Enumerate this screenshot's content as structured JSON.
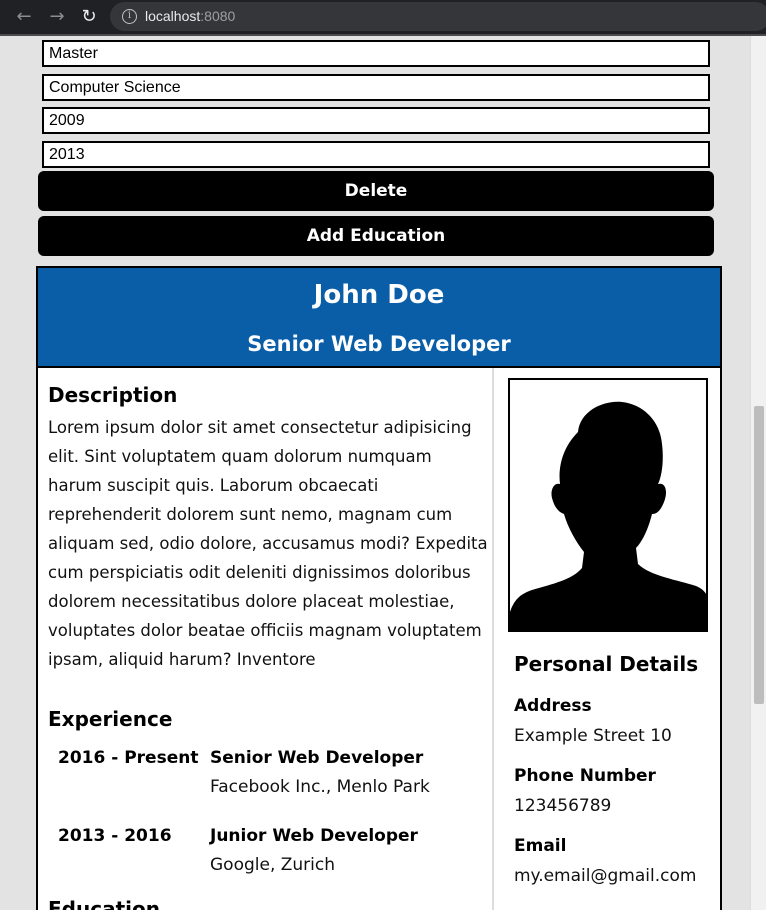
{
  "browser": {
    "url_host": "localhost",
    "url_port": ":8080",
    "back_icon": "arrow-left-icon",
    "forward_icon": "arrow-right-icon",
    "reload_icon": "reload-icon"
  },
  "form": {
    "degree": "Master",
    "field": "Computer Science",
    "start_year": "2009",
    "end_year": "2013",
    "delete_label": "Delete",
    "add_education_label": "Add Education"
  },
  "cv": {
    "name": "John Doe",
    "title": "Senior Web Developer",
    "description_heading": "Description",
    "description": "Lorem ipsum dolor sit amet consectetur adipisicing elit. Sint voluptatem quam dolorum numquam harum suscipit quis. Laborum obcaecati reprehenderit dolorem sunt nemo, magnam cum aliquam sed, odio dolore, accusamus modi? Expedita cum perspiciatis odit deleniti dignissimos doloribus dolorem necessitatibus dolore placeat molestiae, voluptates dolor beatae officiis magnam voluptatem ipsam, aliquid harum? Inventore",
    "experience_heading": "Experience",
    "experience": [
      {
        "years": "2016 - Present",
        "role": "Senior Web Developer",
        "company": "Facebook Inc., Menlo Park"
      },
      {
        "years": "2013 - 2016",
        "role": "Junior Web Developer",
        "company": "Google, Zurich"
      }
    ],
    "education_heading": "Education",
    "personal_details_heading": "Personal Details",
    "details": [
      {
        "label": "Address",
        "value": "Example Street 10"
      },
      {
        "label": "Phone Number",
        "value": "123456789"
      },
      {
        "label": "Email",
        "value": "my.email@gmail.com"
      }
    ]
  },
  "colors": {
    "header_blue": "#0a5ea8",
    "button_black": "#000000"
  }
}
